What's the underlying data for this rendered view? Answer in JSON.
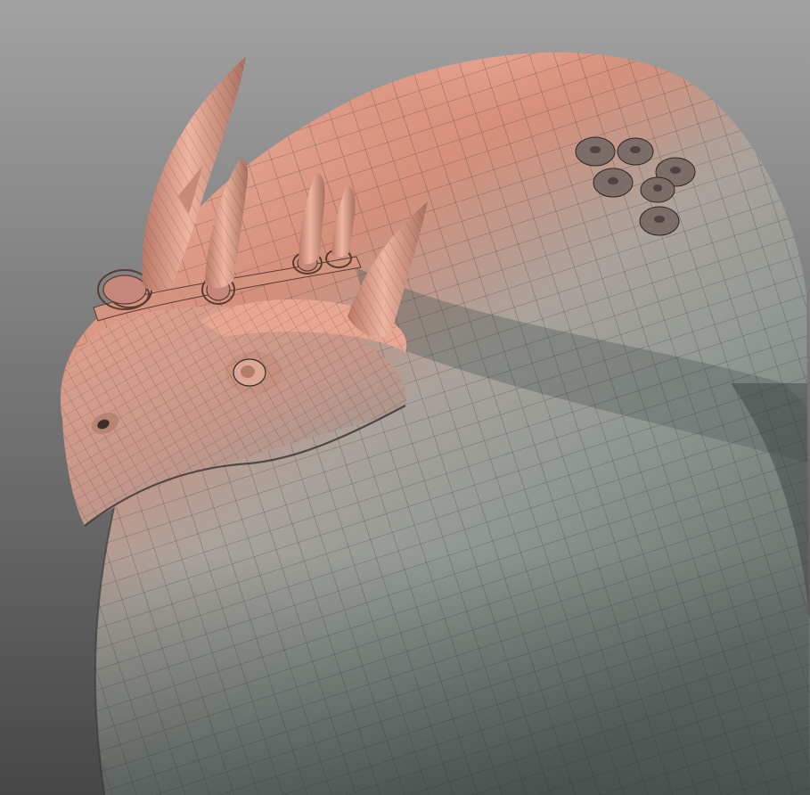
{
  "scene": {
    "subject": "creature-bust-wireframe-render",
    "background_top": "#9b9b9b",
    "background_bottom": "#4b4b4b",
    "skin_warm": "#d9917c",
    "skin_highlight": "#efb19f",
    "skin_cool": "#8e9590",
    "skin_shadow": "#5d6562",
    "wire_color": "#2b2b2b",
    "horn_color": "#c98a76",
    "barnacle_color": "#7d6f6a"
  }
}
